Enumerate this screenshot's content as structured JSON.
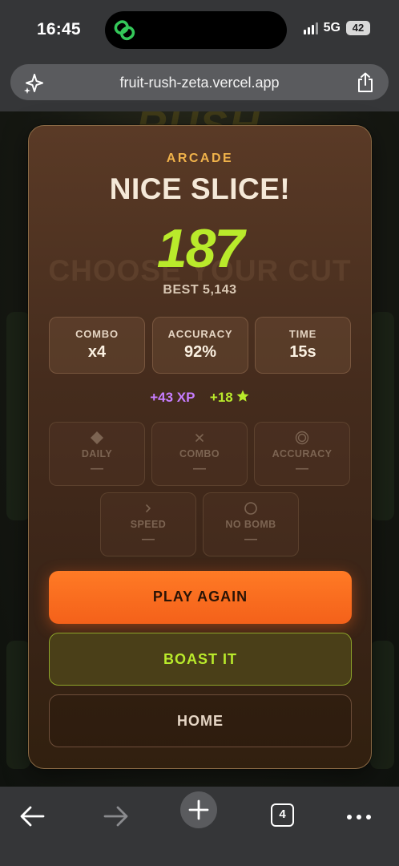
{
  "status_bar": {
    "time": "16:45",
    "network": "5G",
    "battery": "42",
    "island_icon": "link-app-icon"
  },
  "browser": {
    "url": "fruit-rush-zeta.vercel.app",
    "left_icon": "sparkle-icon",
    "right_icon": "share-icon",
    "open_tabs": "4"
  },
  "background": {
    "logo_text": "RUSH",
    "ghost_text": "CHOOSE YOUR CUT"
  },
  "result": {
    "mode": "ARCADE",
    "title": "NICE SLICE!",
    "score": "187",
    "best": "BEST 5,143",
    "stats": [
      {
        "label": "COMBO",
        "value": "x4"
      },
      {
        "label": "ACCURACY",
        "value": "92%"
      },
      {
        "label": "TIME",
        "value": "15s"
      }
    ],
    "rewards": {
      "xp": "+43 XP",
      "stars": "+18"
    },
    "challenges": [
      {
        "icon": "diamond-icon",
        "label": "DAILY",
        "value": "—"
      },
      {
        "icon": "cross-icon",
        "label": "COMBO",
        "value": "—"
      },
      {
        "icon": "target-icon",
        "label": "ACCURACY",
        "value": "—"
      },
      {
        "icon": "chevron-right-icon",
        "label": "SPEED",
        "value": "—"
      },
      {
        "icon": "circle-icon",
        "label": "NO BOMB",
        "value": "—"
      }
    ],
    "buttons": {
      "play_again": "PLAY AGAIN",
      "boast": "BOAST IT",
      "home": "HOME"
    }
  },
  "colors": {
    "score_green": "#b9ea2b",
    "xp_purple": "#c77dff",
    "primary_orange": "#f4611a",
    "label_gold": "#f0b24a"
  }
}
